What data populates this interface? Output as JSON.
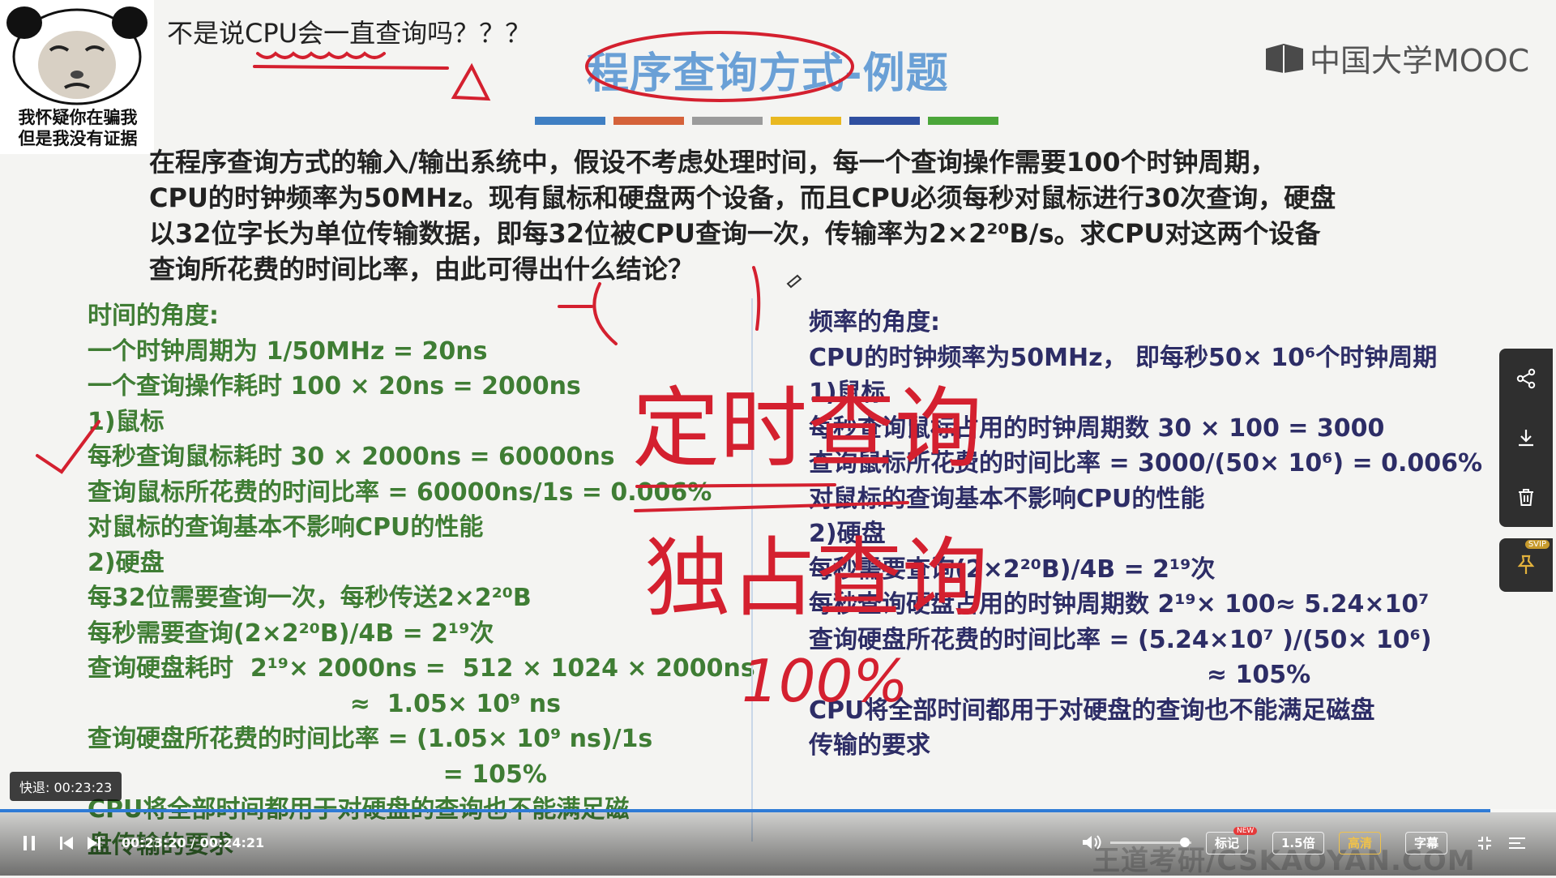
{
  "meme": {
    "caption_line1": "我怀疑你在骗我",
    "caption_line2": "但是我没有证据"
  },
  "comment": "不是说CPU会一直查询吗？？？",
  "slide": {
    "title": "程序查询方式-例题",
    "logo_text": "中国大学MOOC",
    "color_bars": [
      "#3f7fc3",
      "#d5623a",
      "#9b9b9b",
      "#e9b820",
      "#2f4fa0",
      "#4ba63a"
    ],
    "problem": [
      "在程序查询方式的输入/输出系统中，假设不考虑处理时间，每一个查询操作需要100个时钟周期，",
      "CPU的时钟频率为50MHz。现有鼠标和硬盘两个设备，而且CPU必须每秒对鼠标进行30次查询，硬盘",
      "以32位字长为单位传输数据，即每32位被CPU查询一次，传输率为2×2²⁰B/s。求CPU对这两个设备",
      "查询所花费的时间比率，由此可得出什么结论？"
    ],
    "left": [
      "时间的角度:",
      "一个时钟周期为 1/50MHz = 20ns",
      "一个查询操作耗时 100 × 20ns = 2000ns",
      "1)鼠标",
      "每秒查询鼠标耗时 30 × 2000ns = 60000ns",
      "查询鼠标所花费的时间比率 = 60000ns/1s = 0.006%",
      "对鼠标的查询基本不影响CPU的性能",
      "2)硬盘",
      "每32位需要查询一次，每秒传送2×2²⁰B",
      "每秒需要查询(2×2²⁰B)/4B = 2¹⁹次",
      "查询硬盘耗时  2¹⁹× 2000ns =  512 × 1024 × 2000ns",
      "                               ≈  1.05× 10⁹ ns",
      "查询硬盘所花费的时间比率 = (1.05× 10⁹ ns)/1s",
      "                                          = 105%",
      "CPU将全部时间都用于对硬盘的查询也不能满足磁",
      "盘传输的要求"
    ],
    "right": [
      "频率的角度:",
      "CPU的时钟频率为50MHz， 即每秒50× 10⁶个时钟周期",
      "1)鼠标",
      "每秒查询鼠标占用的时钟周期数 30 × 100 = 3000",
      "查询鼠标所花费的时间比率 = 3000/(50× 10⁶) = 0.006%",
      "对鼠标的查询基本不影响CPU的性能",
      "2)硬盘",
      "每秒需要查询(2×2²⁰B)/4B = 2¹⁹次",
      "每秒查询硬盘占用的时钟周期数 2¹⁹× 100≈ 5.24×10⁷",
      "查询硬盘所花费的时间比率 = (5.24×10⁷ )/(50× 10⁶)",
      "                                               ≈ 105%",
      "CPU将全部时间都用于对硬盘的查询也不能满足磁盘",
      "传输的要求"
    ]
  },
  "handwriting": {
    "line1": "定时查询",
    "line2": "独占查询",
    "percent": "100%"
  },
  "player": {
    "seek_tooltip": "快退: 00:23:23",
    "time": "00:23:20 / 00:24:21",
    "progress": 0.958,
    "volume": 0.8,
    "mark_label": "标记",
    "new_badge": "NEW",
    "speed_label": "1.5倍",
    "quality_label": "高清",
    "subtitle_label": "字幕",
    "svip_label": "SVIP",
    "watermark": "王道考研/CSKAOYAN.COM"
  }
}
